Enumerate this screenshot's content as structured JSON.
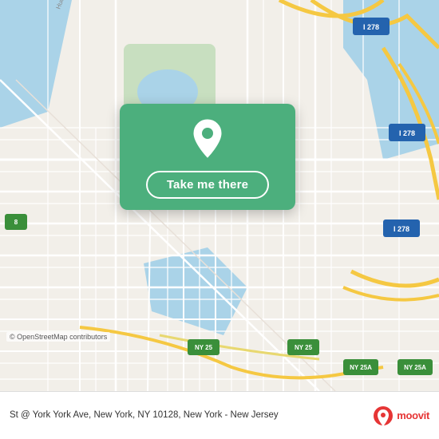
{
  "map": {
    "background_color": "#f2efe9"
  },
  "card": {
    "button_label": "Take me there",
    "background_color": "#4caf7d"
  },
  "bottom": {
    "address": "St @ York York Ave, New York, NY 10128, New York - New Jersey",
    "osm_credit": "© OpenStreetMap contributors",
    "moovit_label": "moovit"
  },
  "badges": [
    {
      "label": "I 278",
      "color": "#2196F3"
    },
    {
      "label": "NY 25",
      "color": "#4caf50"
    },
    {
      "label": "NY 25A",
      "color": "#4caf50"
    }
  ]
}
